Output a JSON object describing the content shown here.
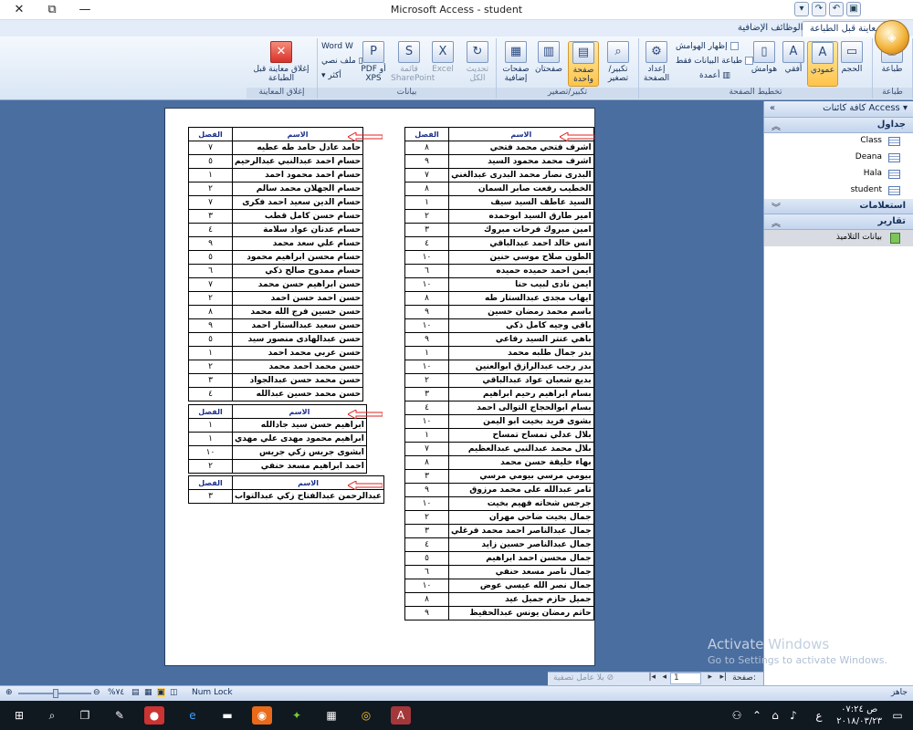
{
  "window": {
    "title": "Microsoft Access - student"
  },
  "tabs": {
    "preview": "معاينة قبل الطباعة",
    "addins": "الوظائف الإضافية"
  },
  "ribbon": {
    "print": {
      "print": "طباعة",
      "group": "طباعة"
    },
    "page_layout": {
      "size": "الحجم",
      "portrait": "عمودي",
      "landscape": "أفقي",
      "margins": "هوامش",
      "show_margins": "إظهار الهوامش",
      "print_data_only": "طباعة البيانات فقط",
      "columns": "أعمدة",
      "setup": "إعداد الصفحة",
      "group": "تخطيط الصفحة"
    },
    "zoom": {
      "zoom": "تكبير/تصغير",
      "one_page": "صفحة واحدة",
      "two_pages": "صفحتان",
      "more_pages": "صفحات إضافية",
      "group": "تكبير/تصغير"
    },
    "data": {
      "refresh": "تحديث الكل",
      "excel": "Excel",
      "sharepoint": "قائمة SharePoint",
      "pdf": "PDF أو XPS",
      "word": "Word",
      "text_file": "ملف نصي",
      "more": "أكثر",
      "group": "بيانات"
    },
    "close": {
      "close": "إغلاق معاينة قبل الطباعة",
      "group": "إغلاق المعاينة"
    }
  },
  "nav": {
    "header": "كافة كائنات Access",
    "sections": {
      "tables": "جداول",
      "queries": "استعلامات",
      "reports": "تقارير"
    },
    "tables": [
      "Class",
      "Deana",
      "Hala",
      "student"
    ],
    "reports": [
      "بيانات التلاميذ"
    ]
  },
  "report": {
    "col_name": "الاسم",
    "col_class": "الفصل",
    "right_rows": [
      [
        "اشرف فتحي محمد فتحي",
        "٨"
      ],
      [
        "اشرف محمد محمود السيد",
        "٩"
      ],
      [
        "البدرى نصار محمد البدرى عبدالغني",
        "٧"
      ],
      [
        "الخطيب رفعت صابر السمان",
        "٨"
      ],
      [
        "السيد عاطف السيد سيف",
        "١"
      ],
      [
        "امير طارق السيد ابوحمده",
        "٢"
      ],
      [
        "امين مبروك فرحات مبروك",
        "٣"
      ],
      [
        "انس خالد احمد عبدالباقي",
        "٤"
      ],
      [
        "الطون صلاح موسي حنين",
        "١٠"
      ],
      [
        "ايمن احمد حميده حميده",
        "٦"
      ],
      [
        "ايمن نادى لبيب حنا",
        "١٠"
      ],
      [
        "ايهاب مجدى عبدالستار طه",
        "٨"
      ],
      [
        "باسم محمد رمضان حسين",
        "٩"
      ],
      [
        "باقي وجيه كامل ذكي",
        "١٠"
      ],
      [
        "باهي عنتر السيد رفاعي",
        "٩"
      ],
      [
        "بدر جمال طلبه محمد",
        "١"
      ],
      [
        "بدر رجب عبدالرازق ابوالعنين",
        "١٠"
      ],
      [
        "بديع شعبان عواد عبدالباقي",
        "٢"
      ],
      [
        "بسام ابراهيم رحيم ابراهيم",
        "٣"
      ],
      [
        "بسام ابوالحجاج التوالى احمد",
        "٤"
      ],
      [
        "بشوى فريد بخيت ابو اليمن",
        "١٠"
      ],
      [
        "بلال عدلي تمساح تمساح",
        "١"
      ],
      [
        "بلال محمد عبدالنبي عبدالعظيم",
        "٧"
      ],
      [
        "بهاء خليفة حسن محمد",
        "٨"
      ],
      [
        "بيومي مرسي بيومي مرسي",
        "٣"
      ],
      [
        "تامر عبدالله على محمد مرزوق",
        "٩"
      ],
      [
        "جرجس شحاته فهيم بخيت",
        "١٠"
      ],
      [
        "جمال بخيت ضاحي مهران",
        "٢"
      ],
      [
        "جمال عبدالناصر احمد محمد فرغلي",
        "٣"
      ],
      [
        "جمال عبدالناصر حسين زايد",
        "٤"
      ],
      [
        "جمال محسن احمد ابراهيم",
        "٥"
      ],
      [
        "جمال ناصر مسعد حنفي",
        "٦"
      ],
      [
        "جمال نصر الله عيسي عوض",
        "١٠"
      ],
      [
        "جميل حازم جميل عيد",
        "٨"
      ],
      [
        "حاتم رمضان يونس عبدالحفيظ",
        "٩"
      ]
    ],
    "left_block1": [
      [
        "حامد عادل حامد طه عطيه",
        "٧"
      ],
      [
        "حسام احمد عبدالنبي عبدالرحيم",
        "٥"
      ],
      [
        "حسام احمد محمود احمد",
        "١"
      ],
      [
        "حسام الجهلان محمد سالم",
        "٢"
      ],
      [
        "حسام الدين سعيد احمد فكرى",
        "٧"
      ],
      [
        "حسام حسن كامل قطب",
        "٣"
      ],
      [
        "حسام عدنان عواد سلامة",
        "٤"
      ],
      [
        "حسام علي سعد محمد",
        "٩"
      ],
      [
        "حسام محسن ابراهيم محمود",
        "٥"
      ],
      [
        "حسام ممدوح صالح ذكي",
        "٦"
      ],
      [
        "حسن ابراهيم حسن محمد",
        "٧"
      ],
      [
        "حسن احمد حسن احمد",
        "٢"
      ],
      [
        "حسن حسين فرج الله محمد",
        "٨"
      ],
      [
        "حسن سعيد عبدالستار احمد",
        "٩"
      ],
      [
        "حسن عبدالهادى منصور سيد",
        "٥"
      ],
      [
        "حسن عربي محمد احمد",
        "١"
      ],
      [
        "حسن محمد احمد محمد",
        "٢"
      ],
      [
        "حسن محمد حسن عبدالجواد",
        "٣"
      ],
      [
        "حسن محمد حسين عبدالله",
        "٤"
      ]
    ],
    "left_block2": [
      [
        "ابراهيم حسن سيد جادالله",
        "١"
      ],
      [
        "ابراهيم محمود مهدى علي مهدي",
        "١"
      ],
      [
        "ابشوى جريس زكي جريس",
        "١٠"
      ],
      [
        "احمد ابراهيم مسعد حنفي",
        "٢"
      ]
    ],
    "left_block3": [
      [
        "عبدالرحمن عبدالفتاح زكي عبدالتواب",
        "٣"
      ]
    ]
  },
  "watermark": {
    "line1": "Activate Windows",
    "line2": "Go to Settings to activate Windows."
  },
  "recnav": {
    "page_label": "صفحة:",
    "page_value": "1",
    "filter": "بلا عامل تصفية"
  },
  "status": {
    "ready": "جاهز",
    "numlock": "Num Lock",
    "zoom": "%٧٤"
  },
  "clock": {
    "time": "ص ٠٧:٢٤",
    "date": "٢٠١٨/٠٣/٢٣"
  },
  "taskbar": {
    "lang": "ع"
  }
}
